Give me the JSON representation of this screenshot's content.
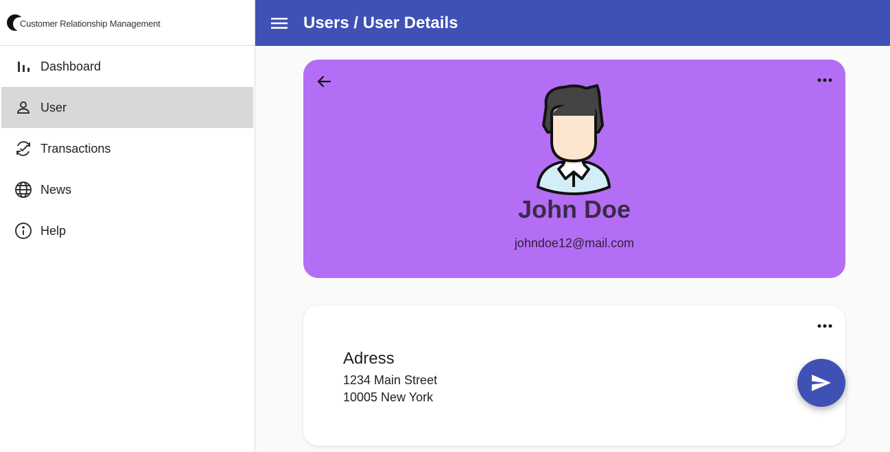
{
  "brand": {
    "name": "Customer Relationship Management"
  },
  "topbar": {
    "title": "Users / User Details",
    "menu_icon": "hamburger-menu-icon"
  },
  "sidebar": {
    "items": [
      {
        "label": "Dashboard",
        "icon": "bar-chart-icon",
        "active": false
      },
      {
        "label": "User",
        "icon": "person-icon",
        "active": true
      },
      {
        "label": "Transactions",
        "icon": "sync-check-icon",
        "active": false
      },
      {
        "label": "News",
        "icon": "globe-icon",
        "active": false
      },
      {
        "label": "Help",
        "icon": "info-icon",
        "active": false
      }
    ]
  },
  "profile": {
    "name": "John Doe",
    "email": "johndoe12@mail.com",
    "background_color": "#b46ef5"
  },
  "address": {
    "title": "Adress",
    "line1": "1234 Main Street",
    "line2": "10005 New York"
  },
  "colors": {
    "primary": "#3f51b5",
    "active_nav": "#d8d8d8"
  }
}
